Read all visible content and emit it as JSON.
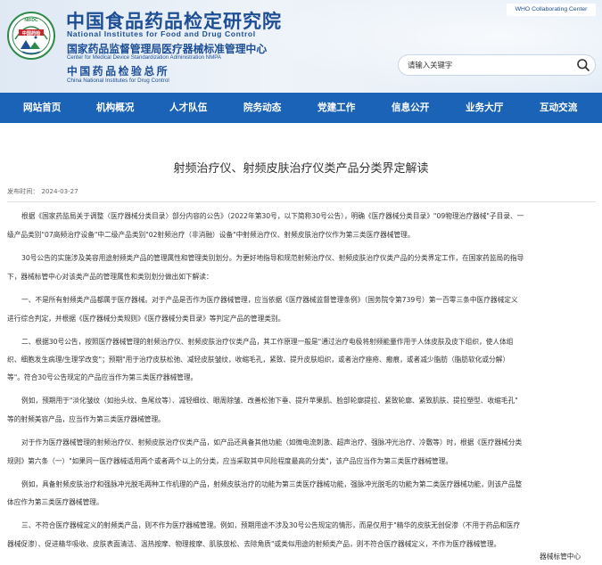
{
  "header": {
    "logo_text": "中国药检",
    "logo_ring_text": "NIFDC",
    "title_cn": "中国食品药品检定研究院",
    "title_en": "National Institutes for Food and Drug Control",
    "sub_cn": "国家药品监督管理局医疗器械标准管理中心",
    "sub_en": "Center for Medical Device Standardization Administration NMPA",
    "sub2_cn": "中国药品检验总所",
    "sub2_en": "China National Institutes for Drug Control",
    "who_badge": "WHO Collaborating Center",
    "colors": {
      "brand": "#1d4e96",
      "nav": "#1a63b7"
    }
  },
  "search": {
    "placeholder": "请输入关键字",
    "icon": "search-icon"
  },
  "nav": {
    "items": [
      {
        "label": "网站首页"
      },
      {
        "label": "机构概况"
      },
      {
        "label": "人才队伍"
      },
      {
        "label": "院务动态"
      },
      {
        "label": "党建工作"
      },
      {
        "label": "信息公开"
      },
      {
        "label": "业务大厅"
      },
      {
        "label": "互动交流"
      }
    ]
  },
  "article": {
    "title": "射频治疗仪、射频皮肤治疗仪类产品分类界定解读",
    "date_label": "发布时间：",
    "date_value": "2024-03-27",
    "lines": [
      "根据《国家药监局关于调整〈医疗器械分类目录〉部分内容的公告》（2022年第30号，以下简称30号公告），明确《医疗器械分类目录》\"09物理治疗器械\"子目录、一",
      "级产品类别\"07高频治疗设备\"中二级产品类别\"02射频治疗（非消融）设备\"中射频治疗仪、射频皮肤治疗仪作为第三类医疗器械管理。",
      "30号公告的实施涉及美容用途射频类产品的管理属性和管理类别划分。为更好地指导和规范射频治疗仪、射频皮肤治疗仪类产品的分类界定工作，在国家药监局的指导",
      "下，器械标管中心对该类产品的管理属性和类别划分做出如下解读：",
      "一、不是所有射频类产品都属于医疗器械。对于产品是否作为医疗器械管理，应当依据《医疗器械监督管理条例》（国务院令第739号）第一百零三条中医疗器械定义",
      "进行综合判定，并根据《医疗器械分类规则》《医疗器械分类目录》等判定产品的管理类别。",
      "二、根据30号公告，按照医疗器械管理的射频治疗仪、射频皮肤治疗仪类产品，其工作原理一般是\"通过治疗电极将射频能量作用于人体皮肤及皮下组织，使人体组",
      "织、细胞发生病理/生理学改变\"；预期\"用于治疗皮肤松弛、减轻皮肤皱纹，收缩毛孔，紧致、提升皮肤组织，或者治疗痤疮、瘢痕，或者减少脂肪（脂肪软化或分解）",
      "等\"。符合30号公告规定的产品应当作为第三类医疗器械管理。",
      "例如，预期用于\"淡化皱纹（如抬头纹、鱼尾纹等）、减轻细纹、眼周除皱、改善松弛下垂、提升苹果肌、脸部轮廓提拉、紧致轮廓、紧致肌肤、提拉塑型、收缩毛孔\"",
      "等的射频美容产品，应当作为第三类医疗器械管理。",
      "对于作为医疗器械管理的射频治疗仪、射频皮肤治疗仪类产品，如产品还具备其他功能（如微电流刺激、超声治疗、强脉冲光治疗、冷敷等）时，根据《医疗器械分类",
      "规则》第六条（一）\"如果同一医疗器械适用两个或者两个以上的分类，应当采取其中风险程度最高的分类\"，该产品应当作为第三类医疗器械管理。",
      "例如，具备射频皮肤治疗和强脉冲光脱毛两种工作机理的产品，射频皮肤治疗的功能为第三类医疗器械功能，强脉冲光脱毛的功能为第二类医疗器械功能，则该产品整",
      "体应作为第三类医疗器械管理。",
      "三、不符合医疗器械定义的射频类产品，则不作为医疗器械管理。例如，预期用途不涉及30号公告规定的情形，而是仅用于\"精华的皮肤无创促渗（不用于药品和医疗",
      "器械促渗）、促进精华吸收、皮肤表面清洁、温热按摩、物理按摩、肌肤放松、去除角质\"或类似用途的射频类产品，则不符合医疗器械定义，不作为医疗器械管理。"
    ],
    "signature": "器械标管中心"
  }
}
